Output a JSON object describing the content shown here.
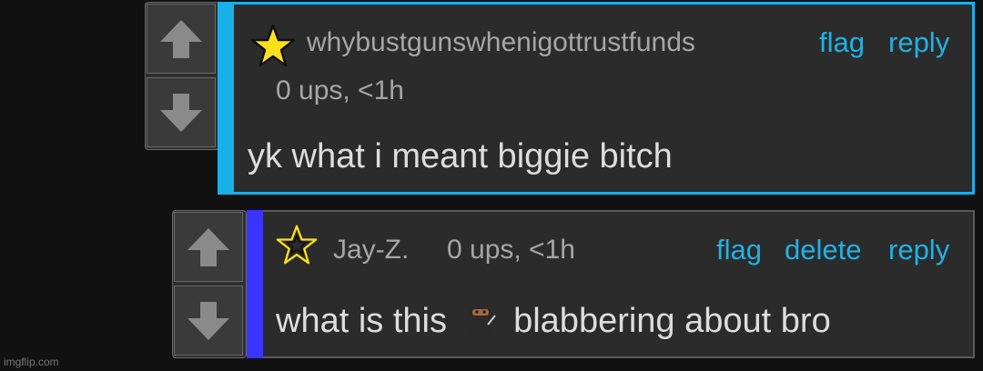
{
  "comments": [
    {
      "username": "whybustgunswhenigottrustfunds",
      "meta": "0 ups, <1h",
      "actions": [
        "flag",
        "reply"
      ],
      "text": "yk what i meant biggie bitch",
      "star_style": "filled",
      "accent": "#19b0e8"
    },
    {
      "username": "Jay-Z.",
      "meta": "0 ups, <1h",
      "actions": [
        "flag",
        "delete",
        "reply"
      ],
      "text_before": "what is this",
      "text_after": "blabbering about bro",
      "star_style": "outlined",
      "accent": "#3a34ff"
    }
  ],
  "watermark": "imgflip.com",
  "icons": [
    "upvote-arrow-icon",
    "downvote-arrow-icon",
    "star-icon",
    "ninja-emoji-icon"
  ]
}
